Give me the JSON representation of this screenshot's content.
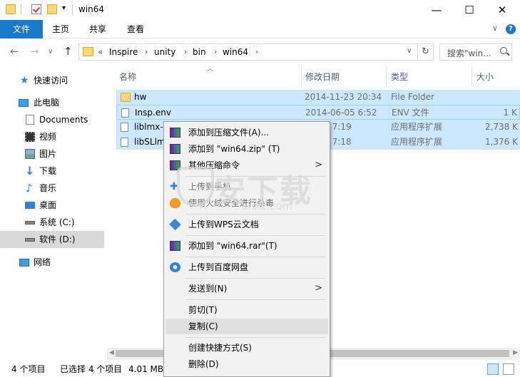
{
  "window": {
    "title": "win64",
    "minimize": "—",
    "maximize": "☐",
    "close": "✕"
  },
  "ribbon": {
    "tabs": [
      "文件",
      "主页",
      "共享",
      "查看"
    ],
    "help": "?"
  },
  "address": {
    "crumbs": [
      "«",
      "Inspire",
      "unity",
      "bin",
      "win64"
    ],
    "search_placeholder": "搜索\"win...",
    "back": "←",
    "forward": "→",
    "recent": "∨",
    "up": "↑",
    "dropdown": "∨",
    "refresh": "↻"
  },
  "sidebar": {
    "items": [
      {
        "label": "快速访问",
        "icon": "star-icon"
      },
      {
        "label": "此电脑",
        "icon": "computer-icon"
      },
      {
        "label": "Documents",
        "icon": "document-icon"
      },
      {
        "label": "视频",
        "icon": "video-icon"
      },
      {
        "label": "图片",
        "icon": "picture-icon"
      },
      {
        "label": "下载",
        "icon": "download-icon"
      },
      {
        "label": "音乐",
        "icon": "music-icon"
      },
      {
        "label": "桌面",
        "icon": "desktop-icon"
      },
      {
        "label": "系统 (C:)",
        "icon": "drive-icon"
      },
      {
        "label": "软件 (D:)",
        "icon": "drive-icon"
      },
      {
        "label": "网络",
        "icon": "network-icon"
      }
    ]
  },
  "list": {
    "columns": [
      "名称",
      "修改日期",
      "类型",
      "大小"
    ],
    "files": [
      {
        "name": "hw",
        "date": "2014-11-23 20:34",
        "type": "File Folder",
        "size": ""
      },
      {
        "name": "Insp.env",
        "date": "2014-06-05 6:52",
        "type": "ENV 文件",
        "size": "1 K"
      },
      {
        "name": "liblmx-",
        "date": "06-05 7:19",
        "type": "应用程序扩展",
        "size": "2,738 K"
      },
      {
        "name": "libSLlm",
        "date": "06-05 7:18",
        "type": "应用程序扩展",
        "size": "1,376 K"
      }
    ]
  },
  "context_menu": {
    "items": [
      {
        "label": "添加到压缩文件(A)...",
        "icon": "winrar-icon"
      },
      {
        "label": "添加到 \"win64.zip\" (T)",
        "icon": "winrar-icon"
      },
      {
        "label": "其他压缩命令",
        "icon": "winrar-icon",
        "arrow": ">"
      },
      {
        "label": "上传到手机",
        "icon": "phone-icon"
      },
      {
        "label": "使用火绒安全进行杀毒",
        "icon": "huorong-icon"
      },
      {
        "label": "上传到WPS云文档",
        "icon": "wps-cloud-icon"
      },
      {
        "label": "添加到 \"win64.rar\"(T)",
        "icon": "winrar-icon"
      },
      {
        "label": "上传到百度网盘",
        "icon": "baidu-netdisk-icon"
      },
      {
        "label": "发送到(N)",
        "icon": "",
        "arrow": ">"
      },
      {
        "label": "剪切(T)",
        "icon": ""
      },
      {
        "label": "复制(C)",
        "icon": ""
      },
      {
        "label": "创建快捷方式(S)",
        "icon": ""
      },
      {
        "label": "删除(D)",
        "icon": ""
      }
    ]
  },
  "watermark": {
    "big": "安下载",
    "small": "anxz.com"
  },
  "status": {
    "count": "4 个项目",
    "selected": "已选择 4 个项目",
    "size": "4.01 MB"
  }
}
